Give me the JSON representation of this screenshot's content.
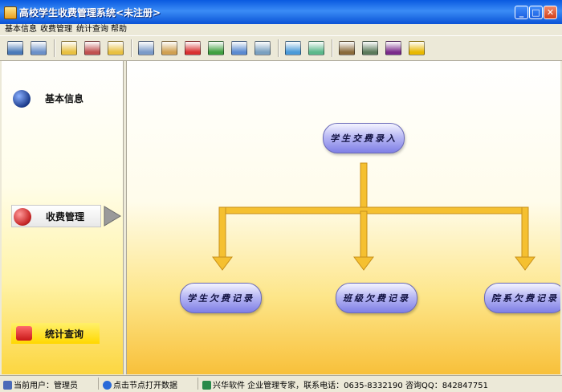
{
  "window": {
    "title": "高校学生收费管理系统<未注册>"
  },
  "menu": {
    "items": [
      "基本信息",
      "收费管理",
      "统计查询",
      "帮助"
    ]
  },
  "toolbar": {
    "groups": [
      [
        {
          "icon": "monitor-icon",
          "color": "#4a7ab8"
        },
        {
          "icon": "computer-icon",
          "color": "#6a90c8"
        }
      ],
      [
        {
          "icon": "folder-open-icon",
          "color": "#e8c040"
        },
        {
          "icon": "users-icon",
          "color": "#c05050"
        },
        {
          "icon": "folder-icon",
          "color": "#e8c040"
        }
      ],
      [
        {
          "icon": "film-icon",
          "color": "#7a9ac8"
        },
        {
          "icon": "edit-document-icon",
          "color": "#d0a050"
        },
        {
          "icon": "umbrella-icon",
          "color": "#d83030"
        },
        {
          "icon": "notebook-icon",
          "color": "#40a040"
        },
        {
          "icon": "search-document-icon",
          "color": "#5a8ad0"
        },
        {
          "icon": "magnifier-icon",
          "color": "#7aa0c0"
        }
      ],
      [
        {
          "icon": "bell-icon",
          "color": "#4a9ad8"
        },
        {
          "icon": "note-icon",
          "color": "#5ab88a"
        }
      ],
      [
        {
          "icon": "picture-icon",
          "color": "#8a6a3a"
        },
        {
          "icon": "pda-icon",
          "color": "#5a7a5a"
        },
        {
          "icon": "help-book-icon",
          "color": "#7a2a8a"
        },
        {
          "icon": "exit-runner-icon",
          "color": "#e8b800"
        }
      ]
    ]
  },
  "sidebar": {
    "items": [
      {
        "label": "基本信息",
        "icon": "globe-icon",
        "color": "#1a3a8a"
      },
      {
        "label": "收费管理",
        "icon": "disc-icon",
        "color": "#c82828"
      },
      {
        "label": "统计查询",
        "icon": "toolbox-icon",
        "color": "#d83030"
      }
    ]
  },
  "flow": {
    "root": "学生交费录入",
    "children": [
      "学生欠费记录",
      "班级欠费记录",
      "院系欠费记录"
    ],
    "arrow_color": "#f5c030"
  },
  "status": {
    "user": "当前用户：管理员",
    "hint": "点击节点打开数据",
    "company": "兴华软件  企业管理专家，联系电话：0635-8332190   咨询QQ：842847751"
  }
}
